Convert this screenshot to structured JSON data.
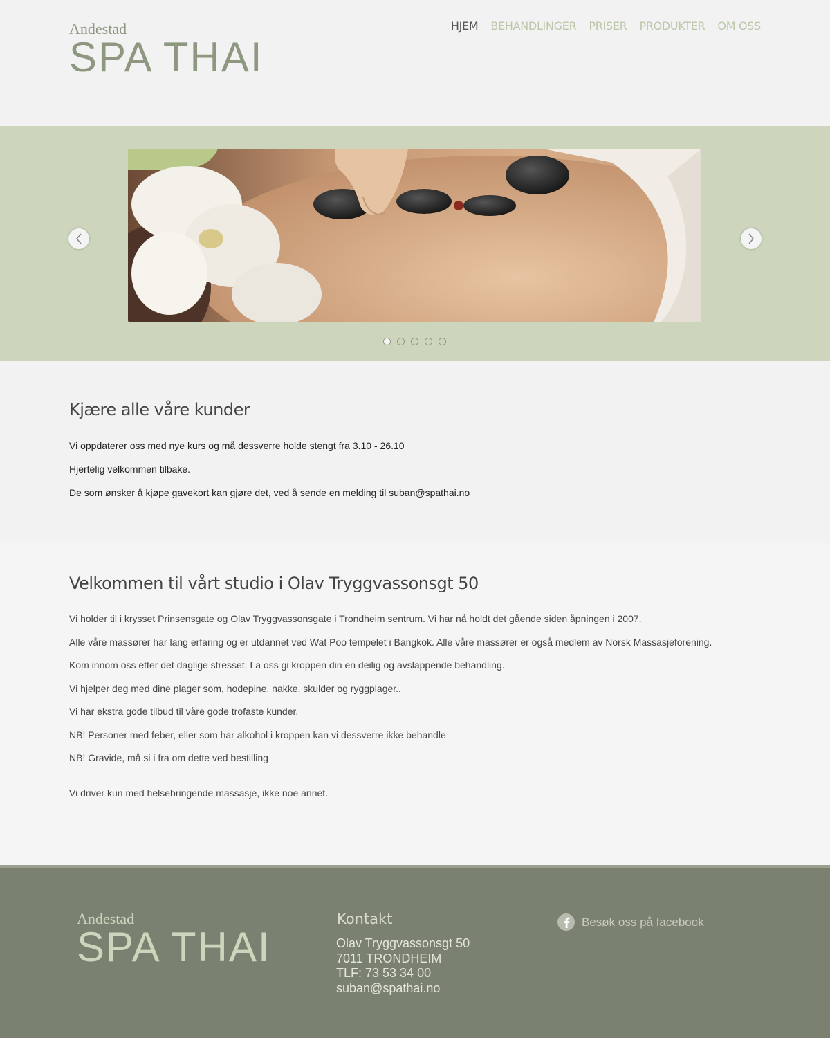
{
  "header": {
    "logo_small": "Andestad",
    "logo_big": "SPA THAI",
    "nav": [
      {
        "label": "HJEM",
        "active": true
      },
      {
        "label": "BEHANDLINGER"
      },
      {
        "label": "PRISER"
      },
      {
        "label": "PRODUKTER"
      },
      {
        "label": "OM OSS"
      }
    ]
  },
  "slider": {
    "prev_icon": "chevron-left-icon",
    "next_icon": "chevron-right-icon",
    "slide_count": 5,
    "active_slide": 1
  },
  "notice": {
    "title": "Kjære alle våre kunder",
    "lines": [
      "Vi oppdaterer oss med nye kurs og må dessverre holde stengt fra 3.10 - 26.10",
      "Hjertelig velkommen tilbake.",
      "De som ønsker å kjøpe gavekort kan gjøre det, ved å sende en melding til suban@spathai.no"
    ]
  },
  "welcome": {
    "title": "Velkommen til vårt studio i Olav Tryggvassonsgt 50",
    "lines": [
      "Vi holder til i krysset Prinsensgate og Olav Tryggvassonsgate i Trondheim sentrum.  Vi har nå holdt det gående siden åpningen i 2007.",
      "Alle våre massører har lang erfaring og er utdannet ved Wat Poo tempelet i Bangkok.  Alle våre massører er også medlem av Norsk Massasjeforening.",
      "Kom innom oss etter det daglige stresset.  La oss gi kroppen din en deilig og avslappende behandling.",
      "Vi hjelper deg med dine plager som, hodepine, nakke, skulder og ryggplager..",
      "Vi har ekstra gode tilbud til våre gode trofaste kunder.",
      "NB!  Personer med feber, eller som har alkohol i kroppen kan vi dessverre ikke behandle",
      "NB!  Gravide, må si i fra om dette ved bestilling",
      "Vi driver kun med helsebringende massasje, ikke noe annet."
    ]
  },
  "footer": {
    "logo_small": "Andestad",
    "logo_big": "SPA THAI",
    "contact_title": "Kontakt",
    "contact_lines": [
      "Olav Tryggvassonsgt 50",
      "7011  TRONDHEIM",
      "TLF: 73 53 34 00",
      "suban@spathai.no"
    ],
    "facebook_label": "Besøk oss på facebook",
    "facebook_icon": "facebook-icon"
  },
  "colors": {
    "accent": "#8e9780",
    "slider_bg": "#cdd5bd",
    "footer_bg": "#7b8170"
  }
}
